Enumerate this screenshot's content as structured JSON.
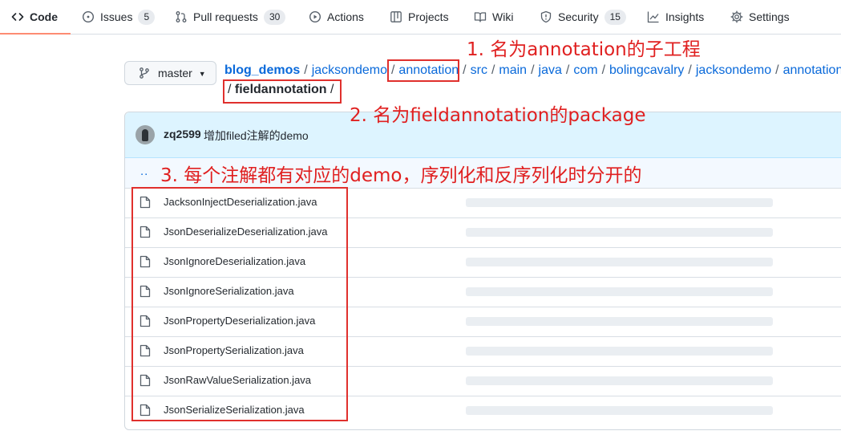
{
  "tabs": [
    {
      "label": "Code",
      "icon": "code-icon"
    },
    {
      "label": "Issues",
      "icon": "issue-opened-icon",
      "count": "5"
    },
    {
      "label": "Pull requests",
      "icon": "git-pull-request-icon",
      "count": "30"
    },
    {
      "label": "Actions",
      "icon": "play-icon"
    },
    {
      "label": "Projects",
      "icon": "table-icon"
    },
    {
      "label": "Wiki",
      "icon": "book-icon"
    },
    {
      "label": "Security",
      "icon": "shield-icon",
      "count": "15"
    },
    {
      "label": "Insights",
      "icon": "graph-icon"
    },
    {
      "label": "Settings",
      "icon": "gear-icon"
    }
  ],
  "branch": {
    "name": "master",
    "icon": "git-branch-icon"
  },
  "breadcrumb": {
    "root": "blog_demos",
    "parts": [
      "jacksondemo",
      "annotation",
      "src",
      "main",
      "java",
      "com",
      "bolingcavalry",
      "jacksondemo",
      "annotation"
    ],
    "final": "fieldannotation"
  },
  "commit": {
    "user": "zq2599",
    "message": "增加filed注解的demo"
  },
  "up_link": "..",
  "files": [
    "JacksonInjectDeserialization.java",
    "JsonDeserializeDeserialization.java",
    "JsonIgnoreDeserialization.java",
    "JsonIgnoreSerialization.java",
    "JsonPropertyDeserialization.java",
    "JsonPropertySerialization.java",
    "JsonRawValueSerialization.java",
    "JsonSerializeSerialization.java"
  ],
  "annotations": {
    "note1": "1. 名为annotation的子工程",
    "note2": "2. 名为fieldannotation的package",
    "note3": "3. 每个注解都有对应的demo，序列化和反序列化时分开的",
    "color": "#e02020"
  },
  "colors": {
    "link": "#0969da",
    "commit_bg": "#ddf4ff",
    "active_tab_underline": "#fd8c73"
  }
}
